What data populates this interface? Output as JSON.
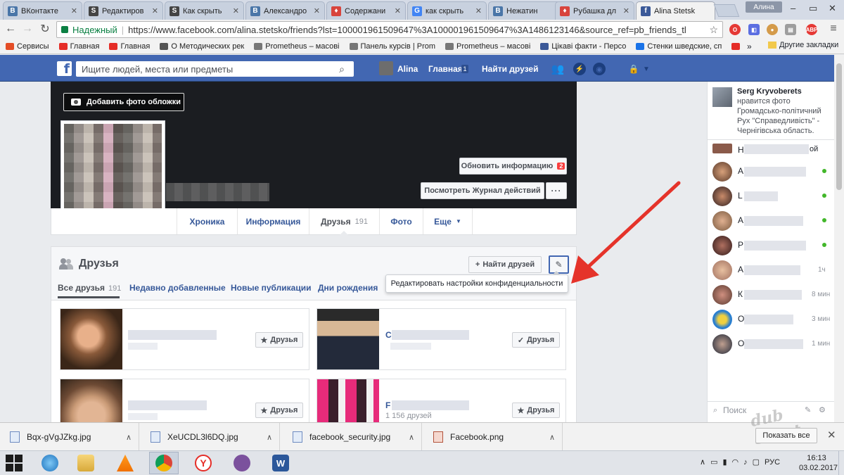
{
  "browser": {
    "tabs": [
      {
        "title": "ВКонтакте",
        "fav_color": "#4a76a8",
        "fav_letter": "В"
      },
      {
        "title": "Редактиров",
        "fav_color": "#444444",
        "fav_letter": "S"
      },
      {
        "title": "Как скрыть",
        "fav_color": "#444444",
        "fav_letter": "S"
      },
      {
        "title": "Александро",
        "fav_color": "#4a76a8",
        "fav_letter": "В"
      },
      {
        "title": "Содержани",
        "fav_color": "#d8443c",
        "fav_letter": "♦"
      },
      {
        "title": "как скрыть",
        "fav_color": "#4285f4",
        "fav_letter": "G"
      },
      {
        "title": "Нежатин",
        "fav_color": "#4a76a8",
        "fav_letter": "В"
      },
      {
        "title": "Рубашка дл",
        "fav_color": "#d8443c",
        "fav_letter": "♦"
      },
      {
        "title": "Alina Stetsk",
        "fav_color": "#3b5998",
        "fav_letter": "f"
      }
    ],
    "window_user": "Алина",
    "secure_label": "Надежный",
    "url": "https://www.facebook.com/alina.stetsko/friends?lst=100001961509647%3A100001961509647%3A1486123146&source_ref=pb_friends_tl",
    "bookmarks": [
      {
        "label": "Сервисы",
        "color": "#e44d26"
      },
      {
        "label": "Главная",
        "color": "#e52d27"
      },
      {
        "label": "Главная",
        "color": "#e52d27"
      },
      {
        "label": "О Методических рек",
        "color": "#555555"
      },
      {
        "label": "Prometheus – масові",
        "color": "#777777"
      },
      {
        "label": "Панель курсів | Prom",
        "color": "#777777"
      },
      {
        "label": "Prometheus – масові",
        "color": "#777777"
      },
      {
        "label": "Цікаві факти - Персо",
        "color": "#3b5998"
      },
      {
        "label": "Стенки шведские, сп",
        "color": "#1a73e8"
      }
    ],
    "bookmarks_more": "»",
    "other_bookmarks": "Другие закладки"
  },
  "fb": {
    "search_placeholder": "Ищите людей, места или предметы",
    "user_name": "Alina",
    "home_label": "Главная",
    "home_badge": "1",
    "find_friends_label": "Найти друзей"
  },
  "profile": {
    "add_cover_label": "Добавить фото обложки",
    "update_info_label": "Обновить информацию",
    "update_info_badge": "2",
    "activity_log_label": "Посмотреть Журнал действий",
    "activity_more_label": "···",
    "tabs": [
      {
        "label": "Хроника"
      },
      {
        "label": "Информация"
      },
      {
        "label": "Друзья",
        "count": "191"
      },
      {
        "label": "Фото"
      },
      {
        "label": "Еще"
      }
    ]
  },
  "friends": {
    "title": "Друзья",
    "find_friends_btn": "Найти друзей",
    "privacy_tooltip": "Редактировать настройки конфиденциальности",
    "tabs": [
      {
        "label": "Все друзья",
        "count": "191"
      },
      {
        "label": "Недавно добавленные"
      },
      {
        "label": "Новые публикации"
      },
      {
        "label": "Дни рождения"
      }
    ],
    "cards": [
      {
        "button": "Друзья",
        "letter": ""
      },
      {
        "button": "Друзья",
        "letter": "С"
      },
      {
        "button": "Друзья",
        "letter": ""
      },
      {
        "button": "Друзья",
        "letter": "F",
        "count": "1 156 друзей"
      }
    ]
  },
  "chat": {
    "ticker_name": "Serg Kryvoberets",
    "ticker_text": "нравится фото Громадсько-політичний Рух \"Справедливість\" - Чернігівська область.",
    "rows": [
      {
        "initial": "Н",
        "suffix": "ой",
        "status": ""
      },
      {
        "initial": "А",
        "status": "online"
      },
      {
        "initial": "L",
        "status": "online"
      },
      {
        "initial": "А",
        "status": "online"
      },
      {
        "initial": "Р",
        "status": "online"
      },
      {
        "initial": "А",
        "time": "1ч"
      },
      {
        "initial": "К",
        "time": "8 мин"
      },
      {
        "initial": "О",
        "time": "3 мин"
      },
      {
        "initial": "О",
        "time": "1 мин"
      }
    ],
    "search_placeholder": "Поиск"
  },
  "downloads": {
    "items": [
      {
        "name": "Bqx-gVgJZkg.jpg"
      },
      {
        "name": "XeUCDL3l6DQ.jpg"
      },
      {
        "name": "facebook_security.jpg"
      },
      {
        "name": "Facebook.png"
      }
    ],
    "show_all": "Показать все"
  },
  "taskbar": {
    "tray_lang": "РУС",
    "time": "16:13",
    "date": "03.02.2017"
  },
  "watermark": "dub Sovet"
}
